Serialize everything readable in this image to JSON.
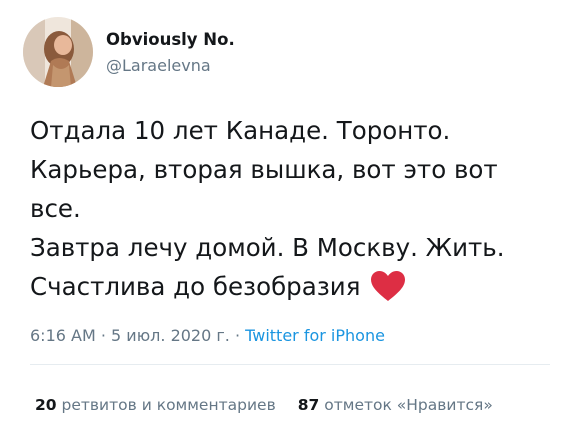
{
  "author": {
    "display_name": "Obviously No.",
    "handle": "@Laraelevna"
  },
  "tweet": {
    "lines": [
      "Отдала 10 лет Канаде. Торонто.",
      "Карьера, вторая вышка, вот это вот",
      "все.",
      "Завтра лечу домой. В Москву. Жить.",
      "Счастлива до безобразия"
    ],
    "emoji": "red-heart-icon"
  },
  "meta": {
    "time": "6:16 AM",
    "sep1": " · ",
    "date": "5 июл. 2020 г.",
    "sep2": " · ",
    "source": "Twitter for iPhone"
  },
  "stats": {
    "retweets_count": "20",
    "retweets_label": "ретвитов и комментариев",
    "likes_count": "87",
    "likes_label": "отметок «Нравится»"
  },
  "colors": {
    "text": "#14171a",
    "secondary": "#657786",
    "link": "#1b95e0",
    "heart": "#e0245e"
  }
}
